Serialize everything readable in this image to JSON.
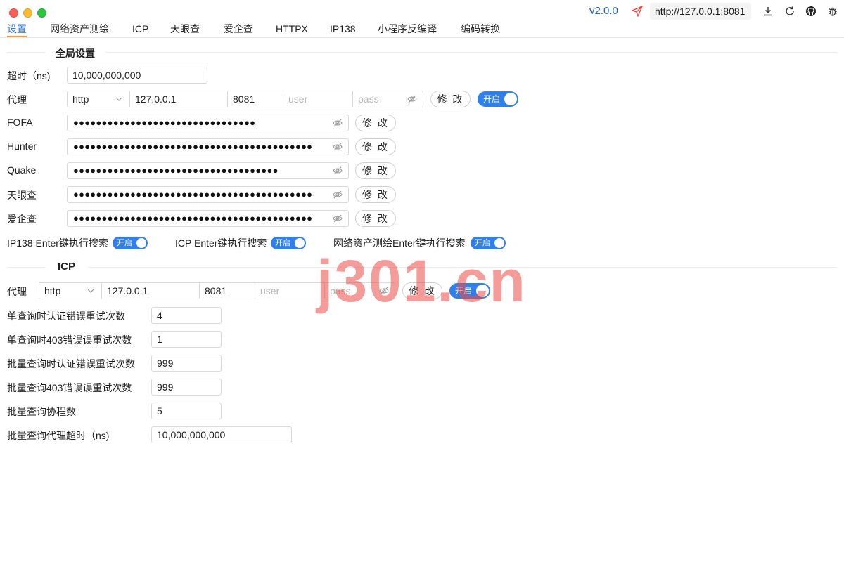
{
  "titlebar": {
    "version": "v2.0.0",
    "url": "http://127.0.0.1:8081",
    "icons": [
      "send-icon",
      "download-icon",
      "refresh-icon",
      "github-icon",
      "bug-icon"
    ]
  },
  "tabs": [
    {
      "label": "设置",
      "active": true
    },
    {
      "label": "网络资产测绘"
    },
    {
      "label": "ICP"
    },
    {
      "label": "天眼查"
    },
    {
      "label": "爱企查"
    },
    {
      "label": "HTTPX"
    },
    {
      "label": "IP138"
    },
    {
      "label": "小程序反编译"
    },
    {
      "label": "编码转换"
    }
  ],
  "global": {
    "title": "全局设置",
    "timeout_label": "超时（ns)",
    "timeout_value": "10,000,000,000",
    "proxy": {
      "label": "代理",
      "type": "http",
      "host": "127.0.0.1",
      "port": "8081",
      "user_placeholder": "user",
      "pass_placeholder": "pass",
      "modify_label": "修 改",
      "toggle_label": "开启",
      "enabled": true
    },
    "keys": [
      {
        "label": "FOFA",
        "dots": "●●●●●●●●●●●●●●●●●●●●●●●●●●●●●●●●",
        "modify": "修 改"
      },
      {
        "label": "Hunter",
        "dots": "●●●●●●●●●●●●●●●●●●●●●●●●●●●●●●●●●●●●●●●●●●",
        "modify": "修 改"
      },
      {
        "label": "Quake",
        "dots": "●●●●●●●●●●●●●●●●●●●●●●●●●●●●●●●●●●●●",
        "modify": "修 改"
      },
      {
        "label": "天眼查",
        "dots": "●●●●●●●●●●●●●●●●●●●●●●●●●●●●●●●●●●●●●●●●●●",
        "modify": "修 改"
      },
      {
        "label": "爱企查",
        "dots": "●●●●●●●●●●●●●●●●●●●●●●●●●●●●●●●●●●●●●●●●●●",
        "modify": "修 改"
      }
    ],
    "enter_toggles": [
      {
        "label": "IP138 Enter键执行搜索",
        "toggle": "开启"
      },
      {
        "label": "ICP Enter键执行搜索",
        "toggle": "开启"
      },
      {
        "label": "网络资产测绘Enter键执行搜索",
        "toggle": "开启"
      }
    ]
  },
  "icp": {
    "title": "ICP",
    "proxy": {
      "label": "代理",
      "type": "http",
      "host": "127.0.0.1",
      "port": "8081",
      "user_placeholder": "user",
      "pass_placeholder": "pass",
      "modify_label": "修 改",
      "toggle_label": "开启",
      "enabled": true
    },
    "fields": [
      {
        "label": "单查询时认证错误重试次数",
        "value": "4"
      },
      {
        "label": "单查询时403错误误重试次数",
        "value": "1"
      },
      {
        "label": "批量查询时认证错误重试次数",
        "value": "999"
      },
      {
        "label": "批量查询403错误误重试次数",
        "value": "999"
      },
      {
        "label": "批量查询协程数",
        "value": "5"
      },
      {
        "label": "批量查询代理超时（ns)",
        "value": "10,000,000,000"
      }
    ]
  },
  "watermark": "j301.cn",
  "colors": {
    "accent": "#2f72d8",
    "toggle": "#2f80ed",
    "tab_underline": "#f39c3d",
    "watermark": "#eb4b46"
  }
}
